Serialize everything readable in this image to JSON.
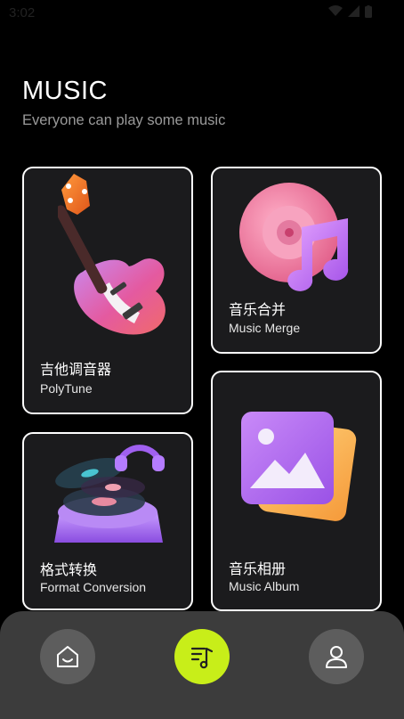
{
  "status_bar": {
    "time": "3:02"
  },
  "header": {
    "title": "MUSIC",
    "subtitle": "Everyone can play some music"
  },
  "cards": {
    "guitar": {
      "title": "吉他调音器",
      "subtitle": "PolyTune"
    },
    "merge": {
      "title": "音乐合并",
      "subtitle": "Music Merge"
    },
    "format": {
      "title": "格式转换",
      "subtitle": "Format Conversion"
    },
    "album": {
      "title": "音乐相册",
      "subtitle": "Music Album"
    }
  },
  "nav": {
    "items": [
      {
        "icon": "home-icon",
        "active": false
      },
      {
        "icon": "music-list-icon",
        "active": true
      },
      {
        "icon": "profile-icon",
        "active": false
      }
    ],
    "active_color": "#c8ee19"
  }
}
